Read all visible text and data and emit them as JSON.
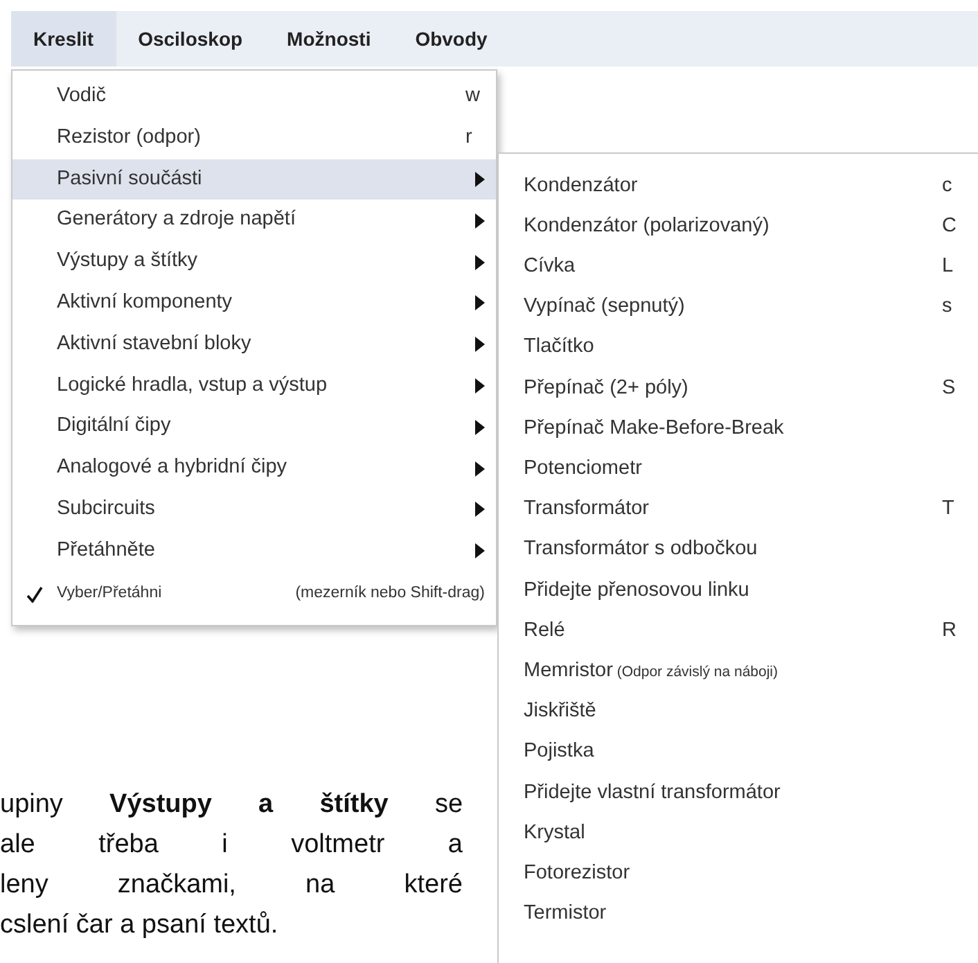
{
  "menubar": [
    {
      "label": "Kreslit",
      "selected": true
    },
    {
      "label": "Osciloskop",
      "selected": false
    },
    {
      "label": "Možnosti",
      "selected": false
    },
    {
      "label": "Obvody",
      "selected": false
    }
  ],
  "menu": {
    "items": [
      {
        "kind": "command",
        "label": "Vodič",
        "shortcut": "w",
        "selected": false
      },
      {
        "kind": "command",
        "label": "Rezistor (odpor)",
        "shortcut": "r",
        "selected": false
      },
      {
        "kind": "submenu",
        "label": "Pasivní součásti",
        "selected": true
      },
      {
        "kind": "submenu",
        "label": "Generátory a zdroje napětí",
        "selected": false
      },
      {
        "kind": "submenu",
        "label": "Výstupy a štítky",
        "selected": false
      },
      {
        "kind": "submenu",
        "label": "Aktivní komponenty",
        "selected": false
      },
      {
        "kind": "submenu",
        "label": "Aktivní stavební bloky",
        "selected": false
      },
      {
        "kind": "submenu",
        "label": "Logické hradla, vstup a výstup",
        "selected": false
      },
      {
        "kind": "submenu",
        "label": "Digitální čipy",
        "selected": false
      },
      {
        "kind": "submenu",
        "label": "Analogové a hybridní čipy",
        "selected": false
      },
      {
        "kind": "submenu",
        "label": "Subcircuits",
        "selected": false
      },
      {
        "kind": "submenu",
        "label": "Přetáhněte",
        "selected": false
      },
      {
        "kind": "check",
        "label": "Vyber/Přetáhni",
        "shortcut": "(mezerník nebo Shift-drag)",
        "checked": true,
        "selected": false
      }
    ]
  },
  "submenu": {
    "items": [
      {
        "label": "Kondenzátor",
        "shortcut": "c"
      },
      {
        "label": "Kondenzátor (polarizovaný)",
        "shortcut": "C"
      },
      {
        "label": "Cívka",
        "shortcut": "L"
      },
      {
        "label": "Vypínač (sepnutý)",
        "shortcut": "s"
      },
      {
        "label": "Tlačítko"
      },
      {
        "label": "Přepínač (2+ póly)",
        "shortcut": "S"
      },
      {
        "label": "Přepínač Make-Before-Break"
      },
      {
        "label": "Potenciometr"
      },
      {
        "label": "Transformátor",
        "shortcut": "T"
      },
      {
        "label": "Transformátor s odbočkou"
      },
      {
        "label": "Přidejte přenosovou linku"
      },
      {
        "label": "Relé",
        "shortcut": "R"
      },
      {
        "label": "Memristor",
        "note": "(Odpor závislý na náboji)"
      },
      {
        "label": "Jiskřiště"
      },
      {
        "label": "Pojistka"
      },
      {
        "label": "Přidejte vlastní transformátor"
      },
      {
        "label": "Krystal"
      },
      {
        "label": "Fotorezistor"
      },
      {
        "label": "Termistor"
      }
    ]
  },
  "paragraph": [
    "upiny **Výstupy a štítky** se",
    "ale třeba i voltmetr a",
    "leny značkami, na které",
    "cslení čar a psaní textů."
  ]
}
